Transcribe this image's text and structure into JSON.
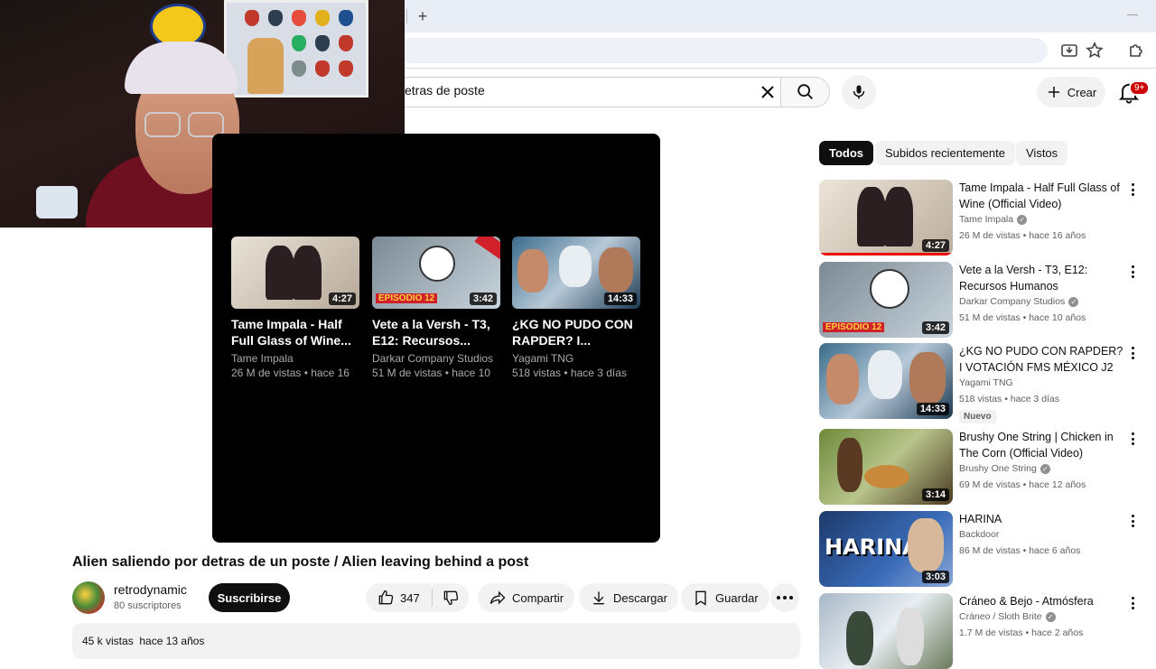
{
  "browser": {
    "new_tab_label": "+"
  },
  "header": {
    "search_value": "etras de poste",
    "create_label": "Crear",
    "notification_count": "9+"
  },
  "player": {
    "end_cards": [
      {
        "title": "Tame Impala - Half Full Glass of Wine...",
        "channel": "Tame Impala",
        "meta": "26 M de vistas • hace 16",
        "duration": "4:27"
      },
      {
        "title": "Vete a la Versh - T3, E12: Recursos...",
        "channel": "Darkar Company Studios",
        "meta": "51 M de vistas • hace 10",
        "duration": "3:42"
      },
      {
        "title": "¿KG NO PUDO CON RAPDER? I...",
        "channel": "Yagami TNG",
        "meta": "518 vistas • hace 3 días",
        "duration": "14:33"
      }
    ]
  },
  "video": {
    "title": "Alien saliendo por detras de un poste / Alien leaving behind a post",
    "channel_name": "retrodynamic",
    "subscribers": "80 suscriptores",
    "subscribe_label": "Suscribirse",
    "likes": "347",
    "share_label": "Compartir",
    "download_label": "Descargar",
    "save_label": "Guardar",
    "views": "45 k vistas",
    "uploaded": "hace 13 años"
  },
  "sidebar": {
    "chips": [
      "Todos",
      "Subidos recientemente",
      "Vistos"
    ],
    "related": [
      {
        "title": "Tame Impala - Half Full Glass of Wine (Official Video)",
        "channel": "Tame Impala",
        "verified": true,
        "meta": "26 M de vistas • hace 16 años",
        "duration": "4:27",
        "badge": ""
      },
      {
        "title": "Vete a la Versh - T3, E12: Recursos Humanos",
        "channel": "Darkar Company Studios",
        "verified": true,
        "meta": "51 M de vistas • hace 10 años",
        "duration": "3:42",
        "badge": ""
      },
      {
        "title": "¿KG NO PUDO CON RAPDER? I VOTACIÓN FMS MÉXICO J2",
        "channel": "Yagami TNG",
        "verified": false,
        "meta": "518 vistas • hace 3 días",
        "duration": "14:33",
        "badge": "Nuevo"
      },
      {
        "title": "Brushy One String | Chicken in The Corn (Official Video)",
        "channel": "Brushy One String",
        "verified": true,
        "meta": "69 M de vistas • hace 12 años",
        "duration": "3:14",
        "badge": ""
      },
      {
        "title": "HARINA",
        "channel": "Backdoor",
        "verified": false,
        "meta": "86 M de vistas • hace 6 años",
        "duration": "3:03",
        "badge": ""
      },
      {
        "title": "Cráneo & Bejo - Atmósfera",
        "channel": "Cráneo / Sloth Brite",
        "verified": true,
        "meta": "1.7 M de vistas • hace 2 años",
        "duration": "",
        "badge": ""
      }
    ]
  }
}
